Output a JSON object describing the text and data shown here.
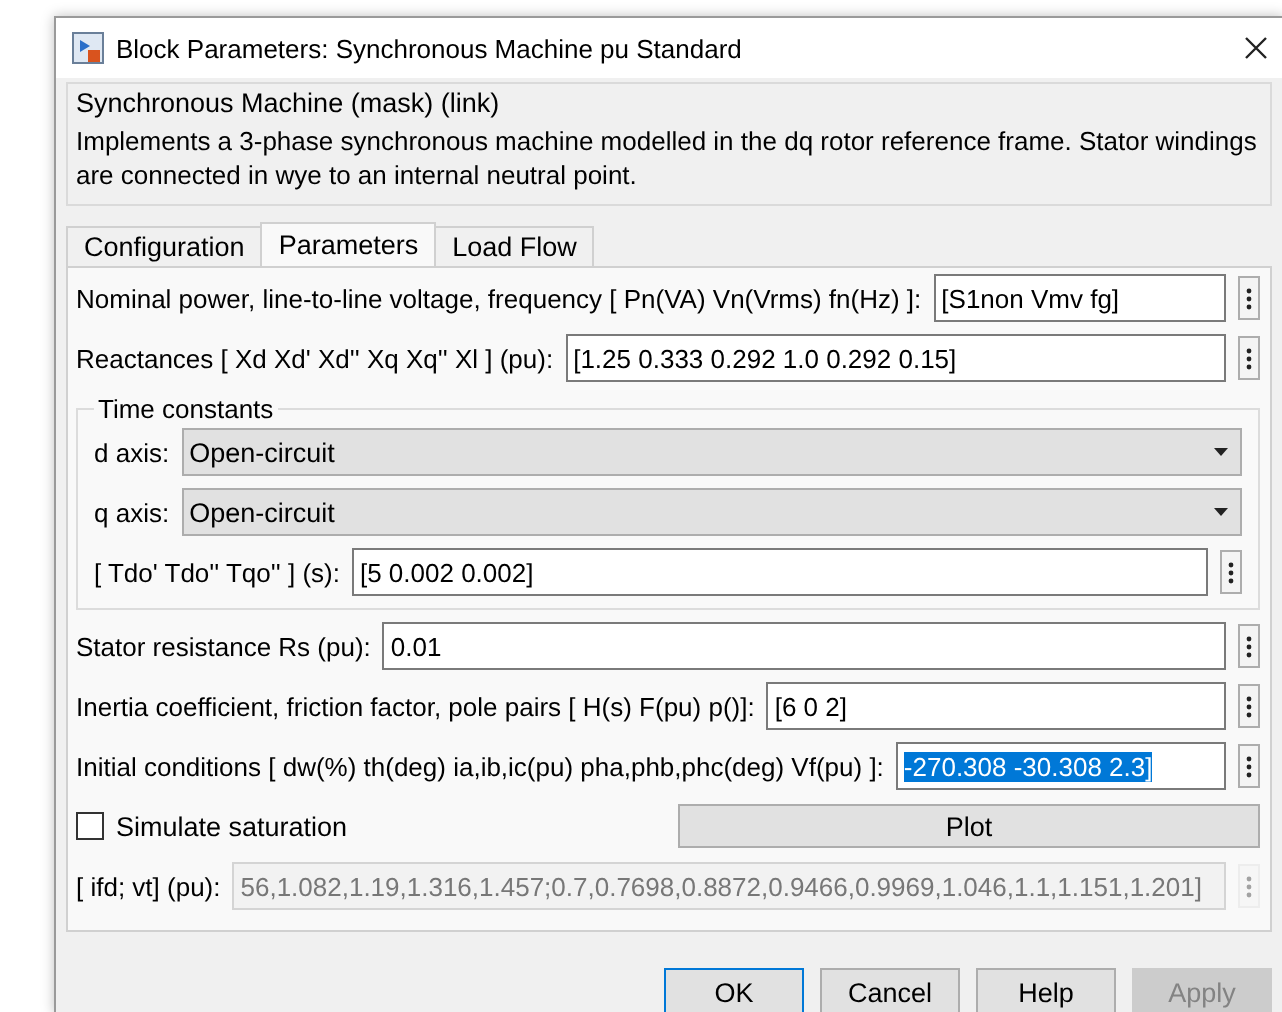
{
  "window": {
    "title": "Block Parameters: Synchronous Machine pu Standard"
  },
  "description": {
    "title": "Synchronous Machine (mask) (link)",
    "text": "Implements a 3-phase synchronous machine modelled in the dq rotor reference frame. Stator windings are connected in wye to an internal neutral point."
  },
  "tabs": [
    {
      "label": "Configuration",
      "selected": false
    },
    {
      "label": "Parameters",
      "selected": true
    },
    {
      "label": "Load Flow",
      "selected": false
    }
  ],
  "fields_top": [
    {
      "label": "Nominal power, line-to-line voltage, frequency [ Pn(VA)  Vn(Vrms)  fn(Hz) ]:",
      "value": "[S1non Vmv fg]",
      "selected": false,
      "disabled": false
    },
    {
      "label": "Reactances [ Xd  Xd'  Xd''  Xq  Xq''  Xl ] (pu):",
      "value": "[1.25 0.333 0.292 1.0 0.292 0.15]",
      "selected": false,
      "disabled": false
    }
  ],
  "time_constants": {
    "title": "Time constants",
    "dropdowns": [
      {
        "label": "d axis:",
        "value": "Open-circuit"
      },
      {
        "label": "q axis:",
        "value": "Open-circuit"
      }
    ],
    "field": {
      "label": "[ Tdo'  Tdo''  Tqo'' ] (s):",
      "value": "[5  0.002  0.002]",
      "selected": false,
      "disabled": false
    }
  },
  "fields_bottom": [
    {
      "label": "Stator resistance Rs (pu):",
      "value": "0.01",
      "selected": false,
      "disabled": false
    },
    {
      "label": "Inertia coefficient, friction factor, pole pairs [ H(s)  F(pu)  p()]:",
      "value": "[6 0 2]",
      "selected": false,
      "disabled": false
    },
    {
      "label": "Initial conditions [ dw(%)  th(deg)  ia,ib,ic(pu)  pha,phb,phc(deg)  Vf(pu) ]:",
      "value": "-270.308 -30.308 2.3]",
      "selected": true,
      "disabled": false
    }
  ],
  "saturation": {
    "label": "Simulate saturation",
    "checked": false,
    "button": "Plot"
  },
  "saturation_field": {
    "label": "[ ifd; vt] (pu):",
    "value": "56,1.082,1.19,1.316,1.457;0.7,0.7698,0.8872,0.9466,0.9969,1.046,1.1,1.151,1.201]",
    "selected": false,
    "disabled": true
  },
  "buttons": [
    {
      "label": "OK",
      "default": true,
      "disabled": false
    },
    {
      "label": "Cancel",
      "default": false,
      "disabled": false
    },
    {
      "label": "Help",
      "default": false,
      "disabled": false
    },
    {
      "label": "Apply",
      "default": false,
      "disabled": true
    }
  ]
}
